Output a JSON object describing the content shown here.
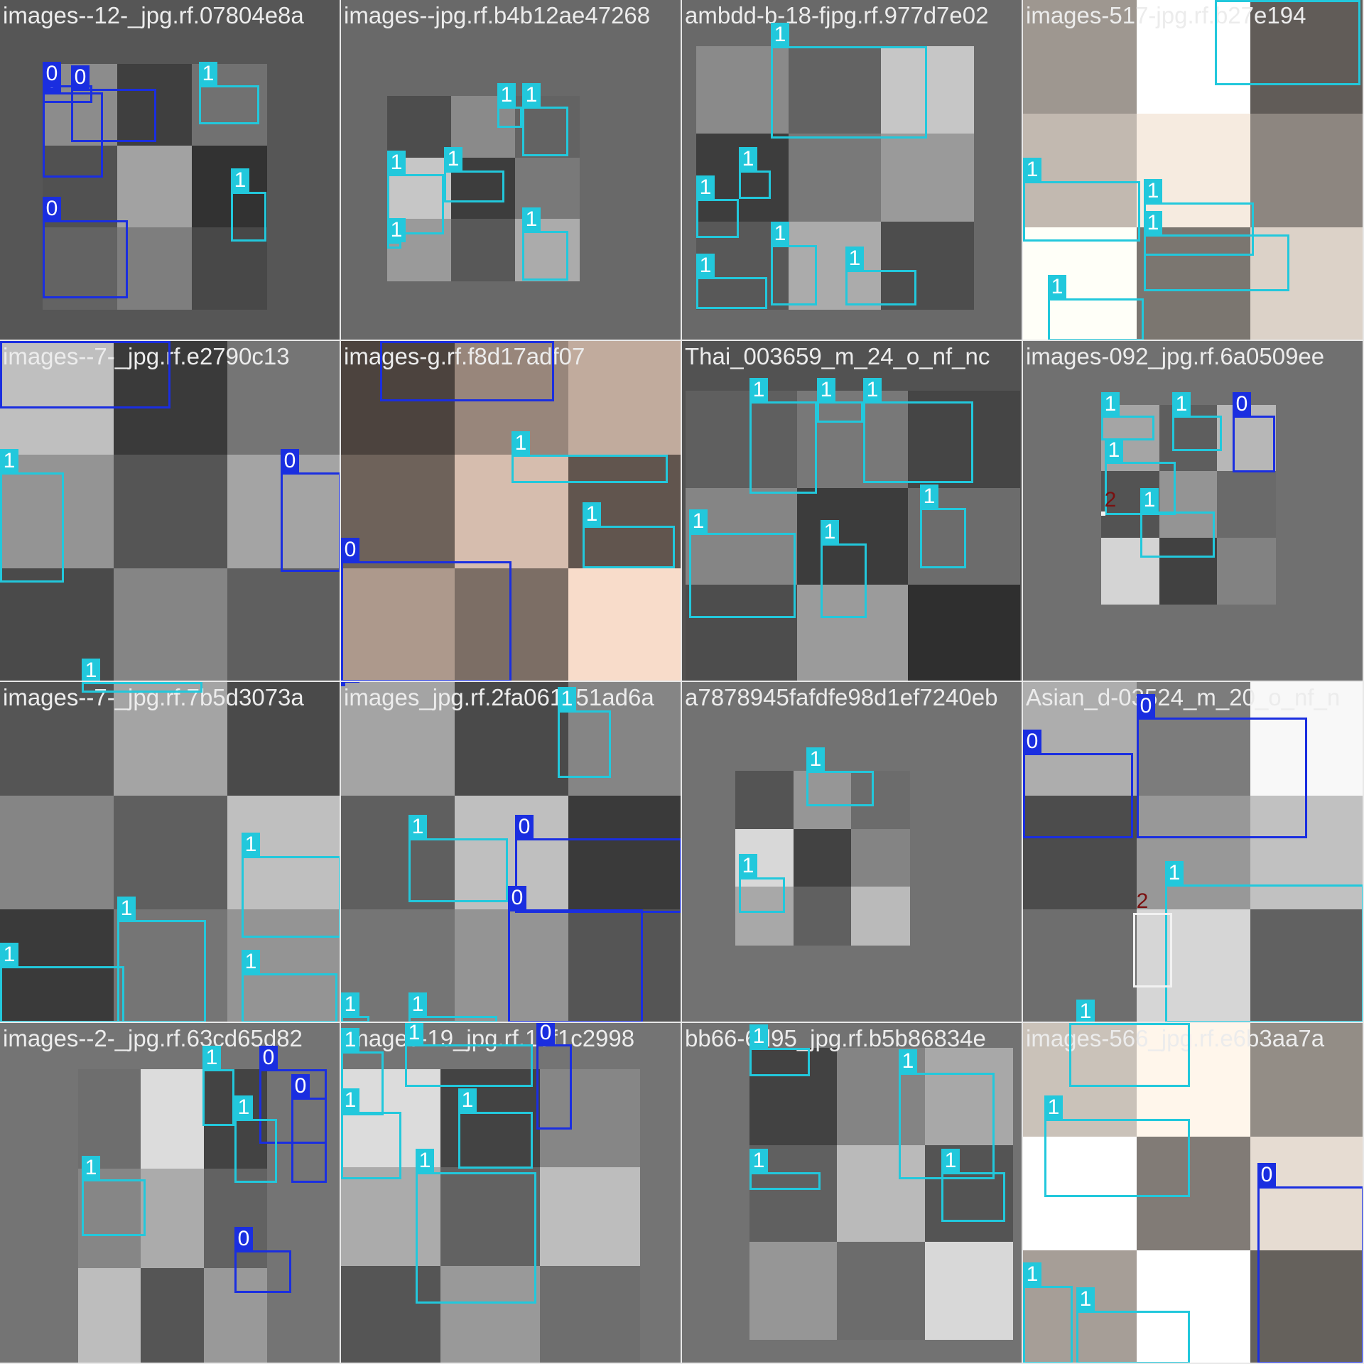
{
  "tiles": [
    {
      "filename": "images--12-_jpg.rf.07804e8a",
      "tone": "#5a5a5a",
      "boxes": [
        {
          "cls": "0"
        },
        {
          "cls": "0"
        },
        {
          "cls": "0"
        },
        {
          "cls": "1"
        },
        {
          "cls": "1"
        },
        {
          "cls": "0"
        }
      ]
    },
    {
      "filename": "images--jpg.rf.b4b12ae47268",
      "tone": "#6e6e6e",
      "boxes": [
        {
          "cls": "1"
        },
        {
          "cls": "1"
        },
        {
          "cls": "1"
        },
        {
          "cls": "1"
        },
        {
          "cls": "1"
        },
        {
          "cls": "1"
        }
      ]
    },
    {
      "filename": "ambdd-b-18-fjpg.rf.977d7e02",
      "tone": "#6e6e6e",
      "boxes": [
        {
          "cls": "1"
        },
        {
          "cls": "1"
        },
        {
          "cls": "1"
        },
        {
          "cls": "1"
        },
        {
          "cls": "1"
        },
        {
          "cls": "1"
        }
      ]
    },
    {
      "filename": "images-517-jpg.rf.b27e194",
      "tone": "#b0a8a0",
      "boxes": [
        {
          "cls": "1"
        },
        {
          "cls": "1"
        },
        {
          "cls": "1"
        },
        {
          "cls": "1"
        },
        {
          "cls": "1"
        }
      ]
    },
    {
      "filename": "images--7-_jpg.rf.e2790c13",
      "tone": "#6a6a6a",
      "boxes": [
        {
          "cls": "0"
        },
        {
          "cls": "1"
        },
        {
          "cls": "0"
        },
        {
          "cls": "1"
        }
      ]
    },
    {
      "filename": "images-g.rf.f8d17adf07",
      "tone": "#8a7a70",
      "boxes": [
        {
          "cls": "0"
        },
        {
          "cls": "1"
        },
        {
          "cls": "0"
        },
        {
          "cls": "1"
        }
      ]
    },
    {
      "filename": "Thai_003659_m_24_o_nf_nc",
      "tone": "#565656",
      "boxes": [
        {
          "cls": "1"
        },
        {
          "cls": "1"
        },
        {
          "cls": "1"
        },
        {
          "cls": "1"
        },
        {
          "cls": "1"
        },
        {
          "cls": "1"
        }
      ]
    },
    {
      "filename": "images-092_jpg.rf.6a0509ee",
      "tone": "#767676",
      "boxes": [
        {
          "cls": "1"
        },
        {
          "cls": "1"
        },
        {
          "cls": "0"
        },
        {
          "cls": "1"
        },
        {
          "cls": "1"
        },
        {
          "cls": "2"
        }
      ]
    },
    {
      "filename": "images--7-_jpg.rf.7b5d3073a",
      "tone": "#6a6a6a",
      "boxes": [
        {
          "cls": "1"
        },
        {
          "cls": "1"
        },
        {
          "cls": "1"
        },
        {
          "cls": "1"
        },
        {
          "cls": "1"
        }
      ]
    },
    {
      "filename": "images_jpg.rf.2fa061b51ad6a",
      "tone": "#6a6a6a",
      "boxes": [
        {
          "cls": "1"
        },
        {
          "cls": "1"
        },
        {
          "cls": "0"
        },
        {
          "cls": "0"
        },
        {
          "cls": "1"
        },
        {
          "cls": "1"
        },
        {
          "cls": "0"
        }
      ]
    },
    {
      "filename": "a7878945fafdfe98d1ef7240eb",
      "tone": "#787878",
      "boxes": [
        {
          "cls": "1"
        },
        {
          "cls": "1"
        }
      ]
    },
    {
      "filename": "Asian_d-03524_m_20_o_nf_n",
      "tone": "#8a8a8a",
      "boxes": [
        {
          "cls": "0"
        },
        {
          "cls": "0"
        },
        {
          "cls": "1"
        },
        {
          "cls": "2"
        },
        {
          "cls": "1"
        }
      ]
    },
    {
      "filename": "images--2-_jpg.rf.63cd65d82",
      "tone": "#7a7a7a",
      "boxes": [
        {
          "cls": "1"
        },
        {
          "cls": "0"
        },
        {
          "cls": "1"
        },
        {
          "cls": "0"
        },
        {
          "cls": "1"
        },
        {
          "cls": "0"
        }
      ]
    },
    {
      "filename": "images-19_jpg.rf.15f1c2998",
      "tone": "#7a7a7a",
      "boxes": [
        {
          "cls": "1"
        },
        {
          "cls": "1"
        },
        {
          "cls": "0"
        },
        {
          "cls": "1"
        },
        {
          "cls": "1"
        },
        {
          "cls": "1"
        }
      ]
    },
    {
      "filename": "bb66-6d95_jpg.rf.b5b86834e",
      "tone": "#787878",
      "boxes": [
        {
          "cls": "1"
        },
        {
          "cls": "1"
        },
        {
          "cls": "1"
        },
        {
          "cls": "1"
        }
      ]
    },
    {
      "filename": "images-566_jpg.rf.e6b3aa7a",
      "tone": "#b8b0a8",
      "boxes": [
        {
          "cls": "1"
        },
        {
          "cls": "1"
        },
        {
          "cls": "0"
        },
        {
          "cls": "1"
        },
        {
          "cls": "1"
        }
      ]
    }
  ]
}
